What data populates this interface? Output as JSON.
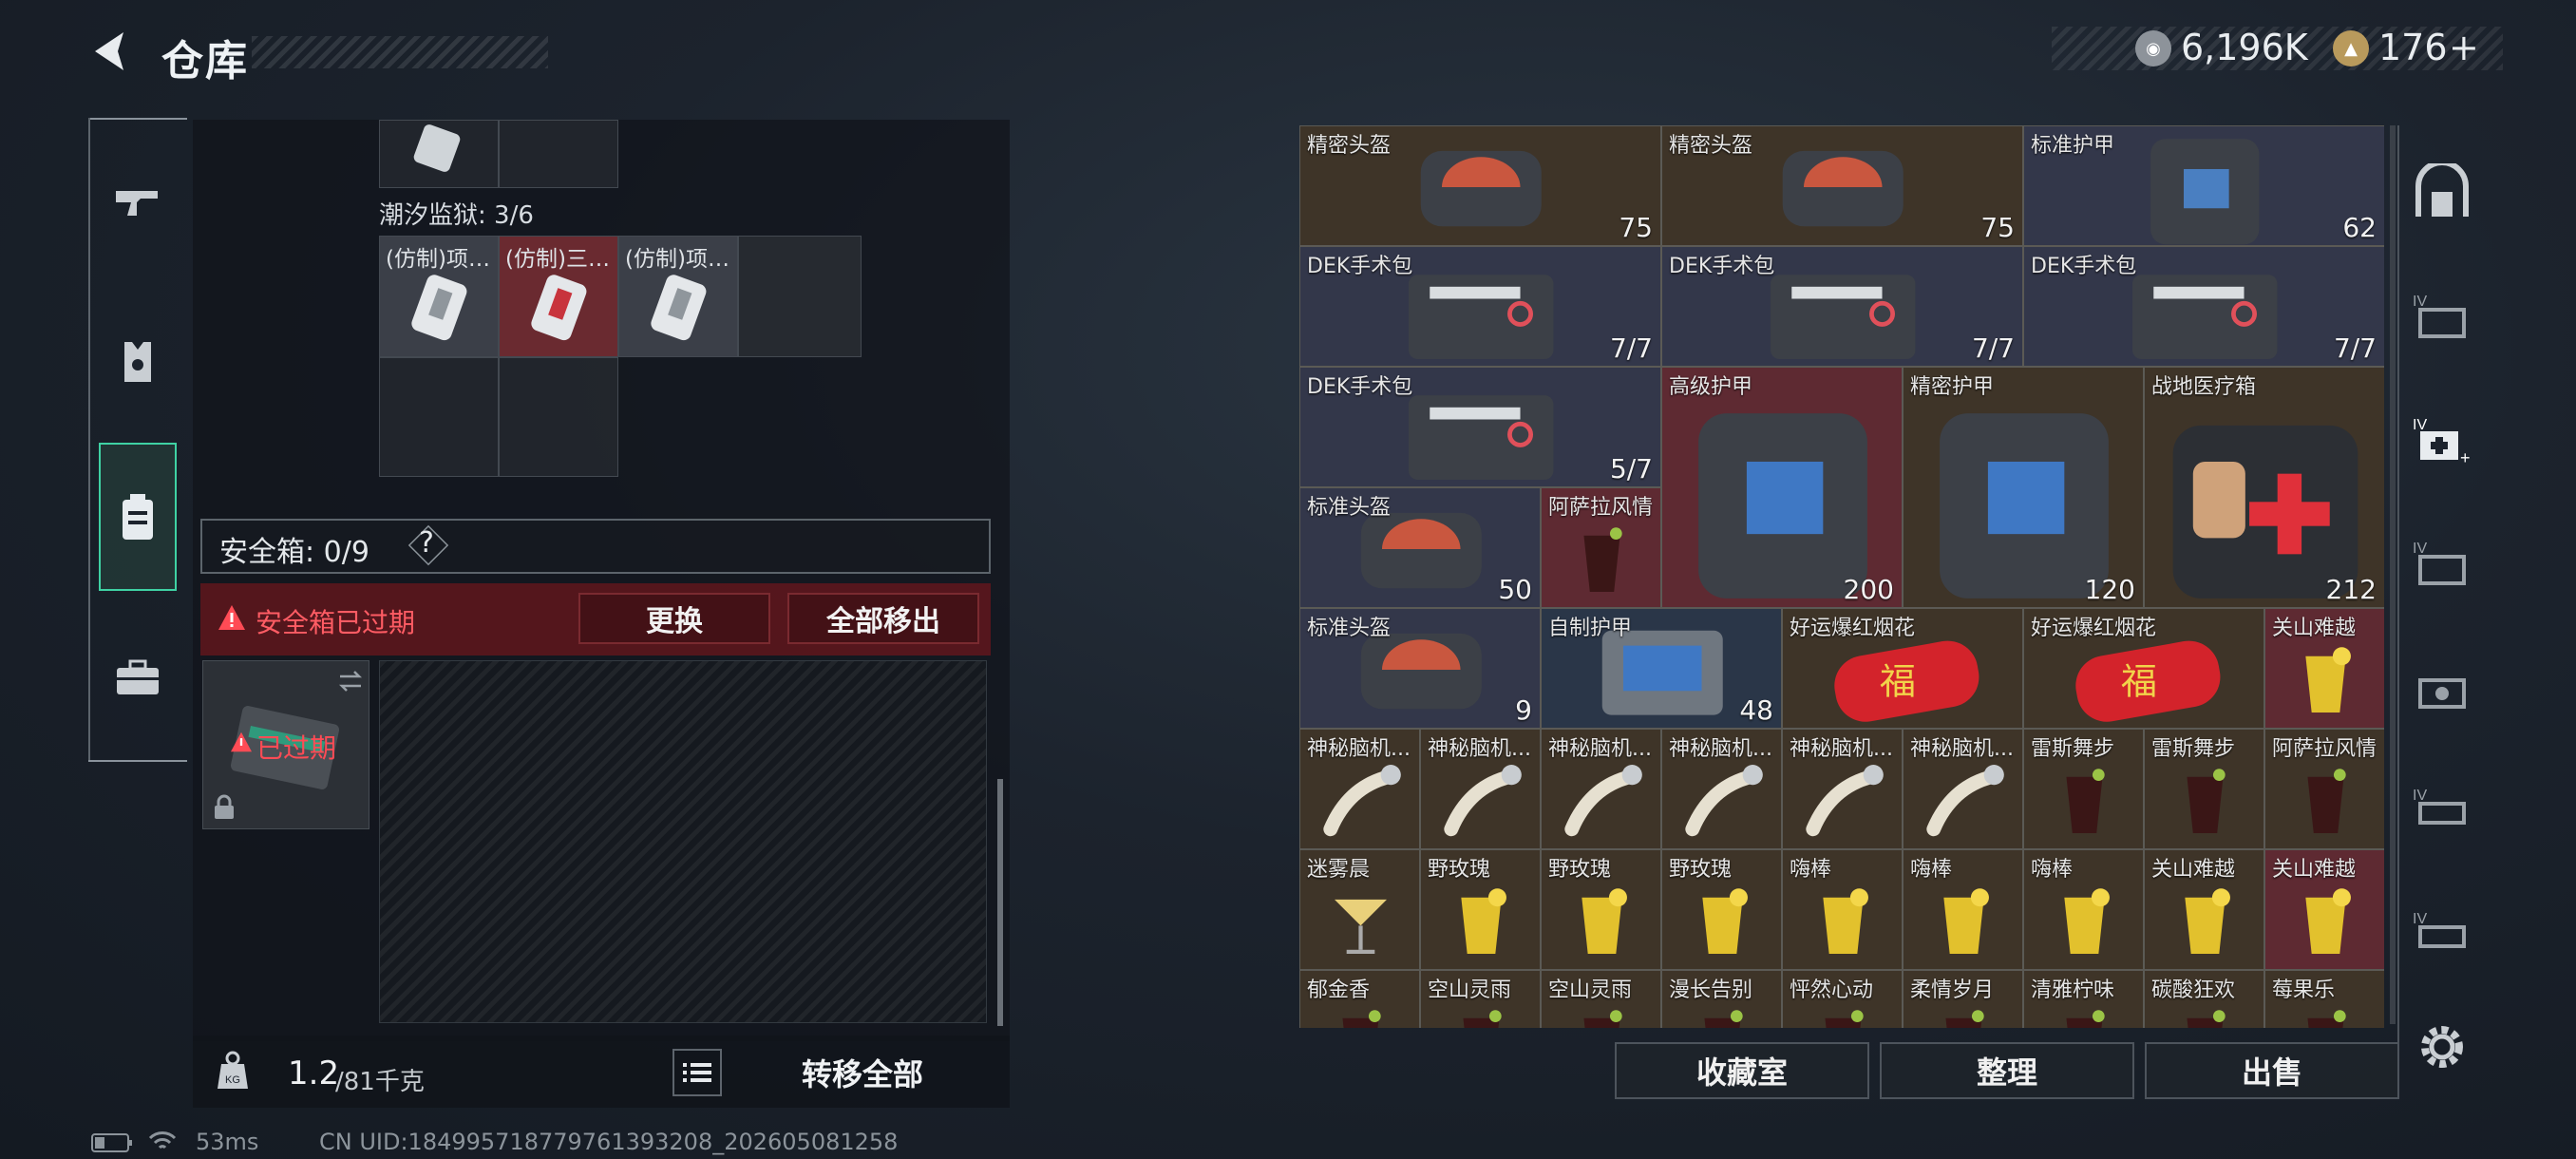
{
  "header": {
    "title": "仓库"
  },
  "currency": {
    "primary": "6,196K",
    "secondary": "176",
    "plus": "+"
  },
  "left": {
    "section_label": "潮汐监狱: 3/6",
    "items": [
      "(仿制)项…",
      "(仿制)三…",
      "(仿制)项…"
    ],
    "safebox_label": "安全箱: 0/9",
    "safebox_help": "?",
    "warning": "安全箱已过期",
    "replace_label": "更换",
    "remove_all_label": "全部移出",
    "expired_badge": "已过期",
    "weight_value": "1.2",
    "weight_max": "/81千克",
    "transfer_all_label": "转移全部"
  },
  "right": {
    "items": [
      {
        "name": "精密头盔",
        "count": "75"
      },
      {
        "name": "精密头盔",
        "count": "75"
      },
      {
        "name": "标准护甲",
        "count": "62"
      },
      {
        "name": "DEK手术包",
        "count": "7/7"
      },
      {
        "name": "DEK手术包",
        "count": "7/7"
      },
      {
        "name": "DEK手术包",
        "count": "7/7"
      },
      {
        "name": "DEK手术包",
        "count": "5/7"
      },
      {
        "name": "高级护甲",
        "count": "200"
      },
      {
        "name": "精密护甲",
        "count": "120"
      },
      {
        "name": "战地医疗箱",
        "count": "212"
      },
      {
        "name": "标准头盔",
        "count": "50"
      },
      {
        "name": "阿萨拉风情",
        "count": ""
      },
      {
        "name": "标准头盔",
        "count": "9"
      },
      {
        "name": "自制护甲",
        "count": "48"
      },
      {
        "name": "好运爆红烟花",
        "count": ""
      },
      {
        "name": "好运爆红烟花",
        "count": ""
      },
      {
        "name": "关山难越",
        "count": ""
      },
      {
        "name": "神秘脑机...",
        "count": ""
      },
      {
        "name": "神秘脑机...",
        "count": ""
      },
      {
        "name": "神秘脑机...",
        "count": ""
      },
      {
        "name": "神秘脑机...",
        "count": ""
      },
      {
        "name": "神秘脑机...",
        "count": ""
      },
      {
        "name": "神秘脑机...",
        "count": ""
      },
      {
        "name": "雷斯舞步",
        "count": ""
      },
      {
        "name": "雷斯舞步",
        "count": ""
      },
      {
        "name": "阿萨拉风情",
        "count": ""
      },
      {
        "name": "迷雾晨",
        "count": ""
      },
      {
        "name": "野玫瑰",
        "count": ""
      },
      {
        "name": "野玫瑰",
        "count": ""
      },
      {
        "name": "野玫瑰",
        "count": ""
      },
      {
        "name": "嗨棒",
        "count": ""
      },
      {
        "name": "嗨棒",
        "count": ""
      },
      {
        "name": "嗨棒",
        "count": ""
      },
      {
        "name": "关山难越",
        "count": ""
      },
      {
        "name": "关山难越",
        "count": ""
      },
      {
        "name": "郁金香",
        "count": ""
      },
      {
        "name": "空山灵雨",
        "count": ""
      },
      {
        "name": "空山灵雨",
        "count": ""
      },
      {
        "name": "漫长告别",
        "count": ""
      },
      {
        "name": "怦然心动",
        "count": ""
      },
      {
        "name": "柔情岁月",
        "count": ""
      },
      {
        "name": "清雅柠味",
        "count": ""
      },
      {
        "name": "碳酸狂欢",
        "count": ""
      },
      {
        "name": "莓果乐",
        "count": ""
      }
    ],
    "collection_label": "收藏室",
    "organize_label": "整理",
    "sell_label": "出售"
  },
  "status": {
    "ping": "53ms",
    "uid": "CN UID:18499571877976139320­8_202605081258"
  },
  "colors": {
    "accent": "#3fd2a4",
    "warning": "#e0454d",
    "danger_bg": "#78161c"
  }
}
